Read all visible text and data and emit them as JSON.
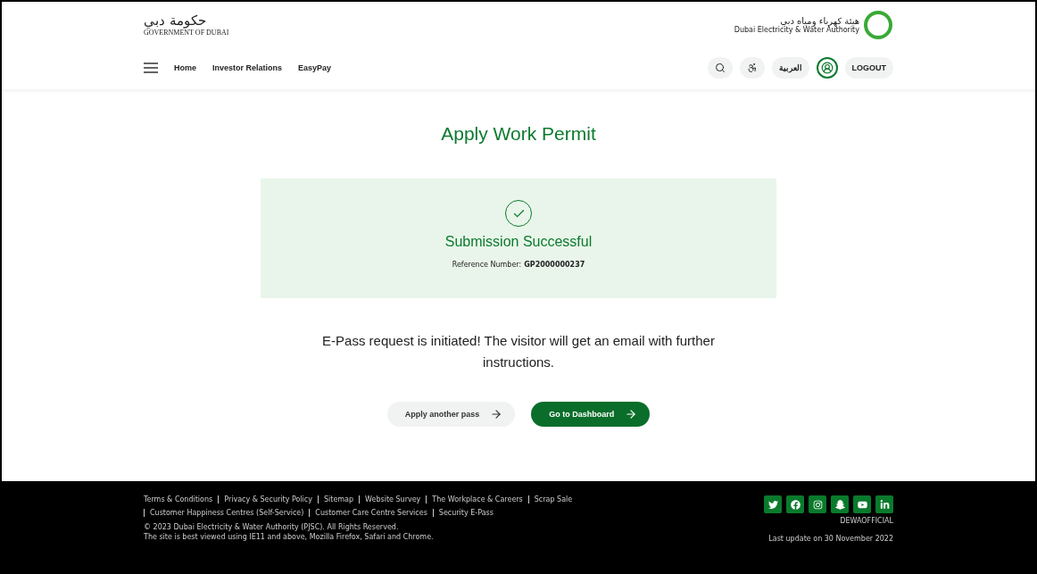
{
  "header": {
    "gov_logo": {
      "arabic": "حكومة دبي",
      "english": "GOVERNMENT OF DUBAI"
    },
    "dewa_logo": {
      "arabic": "هيئة كهرباء ومياه دبي",
      "english": "Dubai Electricity & Water Authority"
    },
    "nav": [
      "Home",
      "Investor Relations",
      "EasyPay"
    ],
    "language": "العربية",
    "logout": "LOGOUT"
  },
  "main": {
    "title": "Apply Work Permit",
    "status": "Submission Successful",
    "reference_label": "Reference Number:",
    "reference_number": "GP2000000237",
    "message": "E-Pass request is initiated! The visitor will get an email with further instructions.",
    "buttons": [
      {
        "label": "Apply another pass",
        "kind": "secondary"
      },
      {
        "label": "Go to Dashboard",
        "kind": "primary"
      }
    ]
  },
  "footer": {
    "link_rows": [
      [
        "Terms & Conditions",
        "Privacy & Security Policy",
        "Sitemap",
        "Website Survey",
        "The Workplace & Careers",
        "Scrap Sale"
      ],
      [
        "Customer Happiness Centres (Self-Service)",
        "Customer Care Centre Services",
        "Security E-Pass"
      ]
    ],
    "copyright": "© 2023 Dubai Electricity & Water Authority (PJSC). All Rights Reserved.",
    "browser_note": "The site is best viewed using IE11 and above, Mozilla Firefox, Safari and Chrome.",
    "social": [
      {
        "kind": "twitter"
      },
      {
        "kind": "facebook"
      },
      {
        "kind": "instagram"
      },
      {
        "kind": "snapchat"
      },
      {
        "kind": "youtube"
      },
      {
        "kind": "linkedin"
      }
    ],
    "handle": "DEWAOFFICIAL",
    "last_update": "Last update on 30 November 2022"
  }
}
